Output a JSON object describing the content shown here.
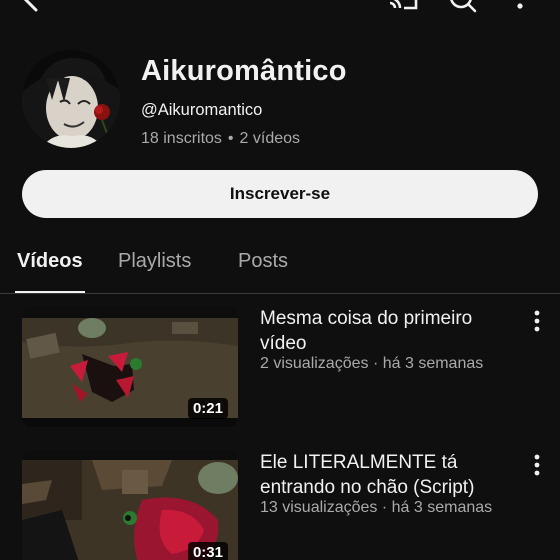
{
  "topbar": {
    "icons": [
      "back-icon",
      "cast-icon",
      "search-icon",
      "more-icon"
    ]
  },
  "channel": {
    "name": "Aikuromântico",
    "handle": "@Aikuromantico",
    "subscribers": "18 inscritos",
    "separator": "•",
    "video_count": "2 vídeos"
  },
  "subscribe": {
    "label": "Inscrever-se"
  },
  "tabs": [
    {
      "label": "Vídeos",
      "active": true
    },
    {
      "label": "Playlists",
      "active": false
    },
    {
      "label": "Posts",
      "active": false
    }
  ],
  "videos": [
    {
      "title": "Mesma coisa do primeiro vídeo",
      "views": "2 visualizações",
      "separator": "·",
      "age": "há 3 semanas",
      "duration": "0:21"
    },
    {
      "title": "Ele LITERALMENTE tá entrando no chão (Script)",
      "views": "13 visualizações",
      "separator": "·",
      "age": "há 3 semanas",
      "duration": "0:31"
    }
  ],
  "colors": {
    "background": "#0f0f0f",
    "text_primary": "#f1f1f1",
    "text_secondary": "#aaaaaa",
    "button_bg": "#f1f1f1"
  }
}
